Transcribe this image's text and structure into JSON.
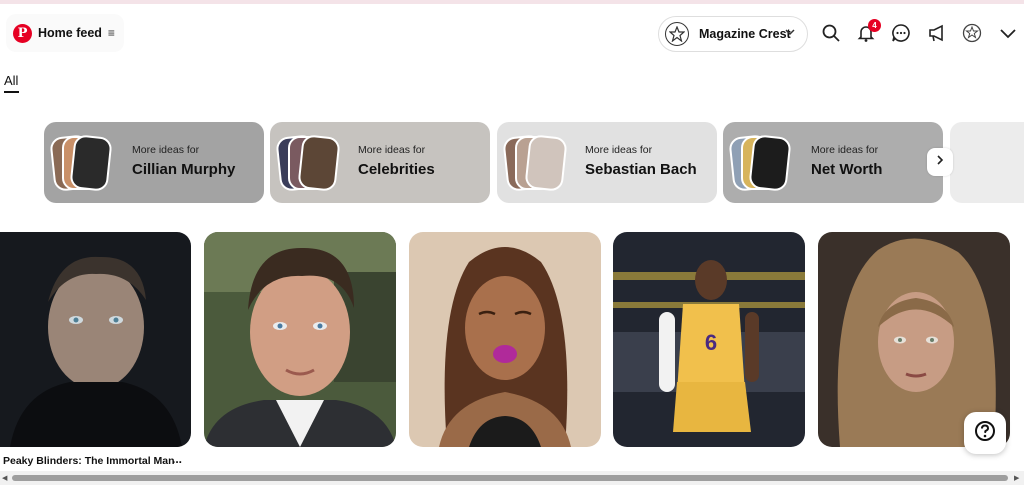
{
  "header": {
    "home_label": "Home feed",
    "menu_glyph": "≡",
    "logo_letter": "P",
    "profile_name": "Magazine Crest",
    "notification_count": "4",
    "icons": [
      "pinterest-logo-icon",
      "menu-icon",
      "chevron-down-icon",
      "search-icon",
      "bell-icon",
      "chat-icon",
      "megaphone-icon",
      "profile-avatar-icon",
      "account-chevron-icon"
    ]
  },
  "tabs": {
    "active": "All"
  },
  "ideas": [
    {
      "prefix": "More ideas for",
      "topic": "Cillian Murphy",
      "bg": "#a3a3a3"
    },
    {
      "prefix": "More ideas for",
      "topic": "Celebrities",
      "bg": "#c6c3bf"
    },
    {
      "prefix": "More ideas for",
      "topic": "Sebastian Bach",
      "bg": "#e1e1e1"
    },
    {
      "prefix": "More ideas for",
      "topic": "Net Worth",
      "bg": "#adadad"
    }
  ],
  "pins": [
    {
      "title": "Peaky Blinders: The Immortal Man",
      "more": "..."
    }
  ],
  "help_glyph": "?",
  "colors": {
    "brand": "#e60023"
  }
}
